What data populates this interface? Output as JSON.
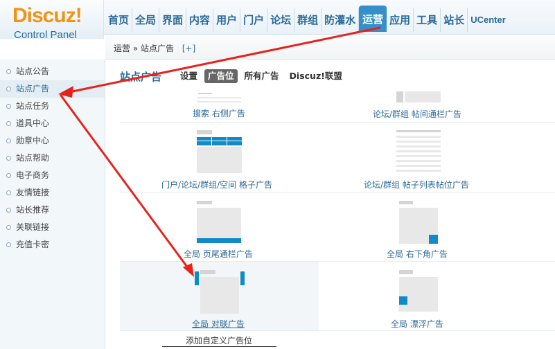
{
  "logo": {
    "title": "Discuz!",
    "subtitle": "Control Panel"
  },
  "nav": {
    "items": [
      "首页",
      "全局",
      "界面",
      "内容",
      "用户",
      "门户",
      "论坛",
      "群组",
      "防灌水",
      "运营",
      "应用",
      "工具",
      "站长",
      "UCenter"
    ],
    "active": "运营"
  },
  "breadcrumb": {
    "section": "运营",
    "separator": "»",
    "page": "站点广告",
    "add": "[+]"
  },
  "sidebar": {
    "items": [
      "站点公告",
      "站点广告",
      "站点任务",
      "道具中心",
      "勋章中心",
      "站点帮助",
      "电子商务",
      "友情链接",
      "站长推荐",
      "关联链接",
      "充值卡密"
    ],
    "active": "站点广告"
  },
  "main": {
    "title": "站点广告",
    "tabs": [
      "设置",
      "广告位",
      "所有广告",
      "Discuz!联盟"
    ],
    "active_tab": "广告位"
  },
  "ad_positions": [
    "搜索 右侧广告",
    "论坛/群组 帖间通栏广告",
    "门户/论坛/群组/空间 格子广告",
    "论坛/群组 帖子列表帖位广告",
    "全局 页尾通栏广告",
    "全局 右下角广告",
    "全局 对联广告",
    "全局 漂浮广告"
  ],
  "add_custom": "添加自定义广告位",
  "colors": {
    "accent": "#3590c9",
    "link": "#2b6a99",
    "logo": "#f29312",
    "arrow": "#e8221b",
    "thumb_blue": "#0f8bc7"
  }
}
